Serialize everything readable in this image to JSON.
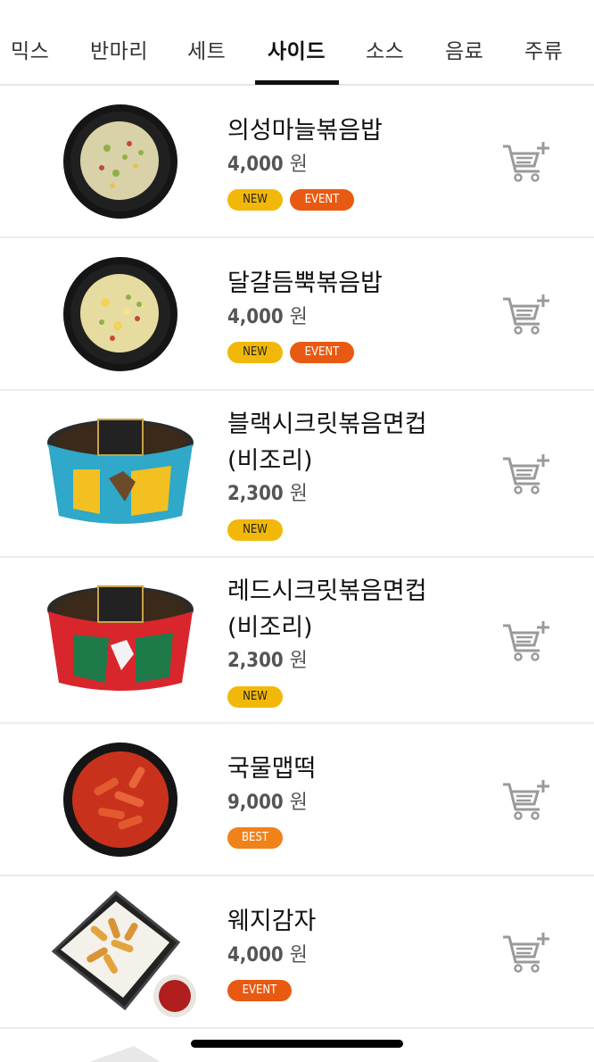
{
  "tabs": [
    {
      "label": "믹스"
    },
    {
      "label": "반마리"
    },
    {
      "label": "세트"
    },
    {
      "label": "사이드"
    },
    {
      "label": "소스"
    },
    {
      "label": "음료"
    },
    {
      "label": "주류"
    }
  ],
  "active_tab": "사이드",
  "colors": {
    "new_badge": "#f2b809",
    "event_badge": "#e85a12",
    "best_badge": "#f0821a",
    "cart_icon": "#9a9a9a"
  },
  "items": [
    {
      "name": "의성마늘볶음밥",
      "name_line2": "",
      "price": "4,000",
      "currency": "원",
      "badges": [
        "NEW",
        "EVENT"
      ],
      "image": "garlic-fried-rice-image",
      "icon": "add-to-cart-icon"
    },
    {
      "name": "달걀듬뿍볶음밥",
      "name_line2": "",
      "price": "4,000",
      "currency": "원",
      "badges": [
        "NEW",
        "EVENT"
      ],
      "image": "egg-fried-rice-image",
      "icon": "add-to-cart-icon"
    },
    {
      "name": "블랙시크릿볶음면컵",
      "name_line2": "(비조리)",
      "price": "2,300",
      "currency": "원",
      "badges": [
        "NEW"
      ],
      "image": "black-noodle-cup-image",
      "icon": "add-to-cart-icon"
    },
    {
      "name": "레드시크릿볶음면컵",
      "name_line2": "(비조리)",
      "price": "2,300",
      "currency": "원",
      "badges": [
        "NEW"
      ],
      "image": "red-noodle-cup-image",
      "icon": "add-to-cart-icon"
    },
    {
      "name": "국물맵떡",
      "name_line2": "",
      "price": "9,000",
      "currency": "원",
      "badges": [
        "BEST"
      ],
      "image": "spicy-tteokbokki-image",
      "icon": "add-to-cart-icon"
    },
    {
      "name": "웨지감자",
      "name_line2": "",
      "price": "4,000",
      "currency": "원",
      "badges": [
        "EVENT"
      ],
      "image": "wedge-potato-image",
      "icon": "add-to-cart-icon"
    }
  ]
}
